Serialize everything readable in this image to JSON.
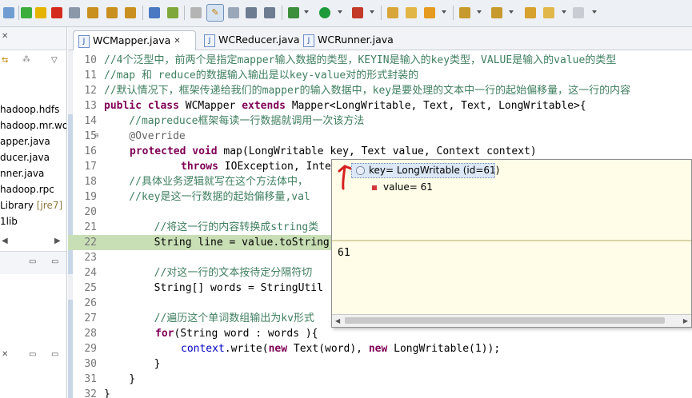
{
  "colors": {
    "comment": "#3f7f5f",
    "keyword": "#7f0055",
    "annotation": "#646464",
    "field": "#0000c0",
    "current_line": "#c8dfb5",
    "hover_bg": "#fffde7"
  },
  "toolbar": {
    "icons": [
      "skip-breakpoints-icon",
      "resume-icon",
      "suspend-icon",
      "terminate-icon",
      "disconnect-icon",
      "step-into-icon",
      "step-over-icon",
      "step-return-icon",
      "drop-to-frame-icon",
      "use-step-filters-icon",
      "toggle-mark-occurrences-icon",
      "highlight-icon",
      "toggle-block-icon",
      "show-whitespace-icon",
      "debug-icon",
      "run-icon",
      "external-tools-icon",
      "new-project-icon",
      "open-icon",
      "search-icon",
      "next-annotation-icon",
      "previous-annotation-icon",
      "last-edit-icon",
      "back-icon",
      "forward-icon"
    ]
  },
  "left_panel": {
    "items": [
      {
        "label": "hadoop.hdfs"
      },
      {
        "label": "hadoop.mr.wo"
      },
      {
        "label": "apper.java"
      },
      {
        "label": "ducer.java"
      },
      {
        "label": "nner.java"
      },
      {
        "label": "hadoop.rpc"
      },
      {
        "label": "Library ",
        "suffix": "[jre7]"
      },
      {
        "label": "1lib"
      }
    ]
  },
  "tabs": [
    {
      "label": "WCMapper.java",
      "close": "✕"
    },
    {
      "label": "WCReducer.java"
    },
    {
      "label": "WCRunner.java"
    }
  ],
  "code": {
    "lines": [
      {
        "n": "10",
        "t": "//4个泛型中，前两个是指定mapper输入数据的类型，KEYIN是输入的key类型，VALUE是输入的value的类型"
      },
      {
        "n": "11",
        "t": "//map 和 reduce的数据输入输出是以key-value对的形式封装的"
      },
      {
        "n": "12",
        "t": "//默认情况下，框架传递给我们的mapper的输入数据中，key是要处理的文本中一行的起始偏移量，这一行的内容"
      },
      {
        "n": "13",
        "kw1": "public class",
        "t1": " WCMapper ",
        "kw2": "extends",
        "t2": " Mapper<LongWritable, Text, Text, LongWritable>{"
      },
      {
        "n": "14",
        "t": "    //mapreduce框架每读一行数据就调用一次该方法"
      },
      {
        "n": "15",
        "t": "    @Override"
      },
      {
        "n": "16",
        "kw1": "protected void",
        "t1": " map(LongWritable key, Text value, Context context)"
      },
      {
        "n": "17",
        "kw1": "throws",
        "t1": " IOException, Inte"
      },
      {
        "n": "18",
        "t": "    //具体业务逻辑就写在这个方法体中，"
      },
      {
        "n": "19",
        "t": "    //key是这一行数据的起始偏移量,val"
      },
      {
        "n": "20",
        "t": ""
      },
      {
        "n": "21",
        "t": "        //将这一行的内容转换成string类"
      },
      {
        "n": "22",
        "t": "        String line = value.toString"
      },
      {
        "n": "23",
        "t": ""
      },
      {
        "n": "24",
        "t": "        //对这一行的文本按待定分隔符切"
      },
      {
        "n": "25",
        "t": "        String[] words = StringUtil"
      },
      {
        "n": "26",
        "t": ""
      },
      {
        "n": "27",
        "t": "        //遍历这个单词数组输出为kv形式"
      },
      {
        "n": "28",
        "kw1": "for",
        "t1": "(String word : words ){"
      },
      {
        "n": "29",
        "t1": "context",
        "t2": ".write(",
        "kw1": "new",
        "t3": " Text(word), ",
        "kw2": "new",
        "t4": " LongWritable(1));"
      },
      {
        "n": "30",
        "t": "        }"
      },
      {
        "n": "31",
        "t": "    }"
      },
      {
        "n": "32",
        "t": "}"
      }
    ]
  },
  "hover": {
    "root": "key= LongWritable  (id=61)",
    "child": "value= 61",
    "detail": "61"
  }
}
